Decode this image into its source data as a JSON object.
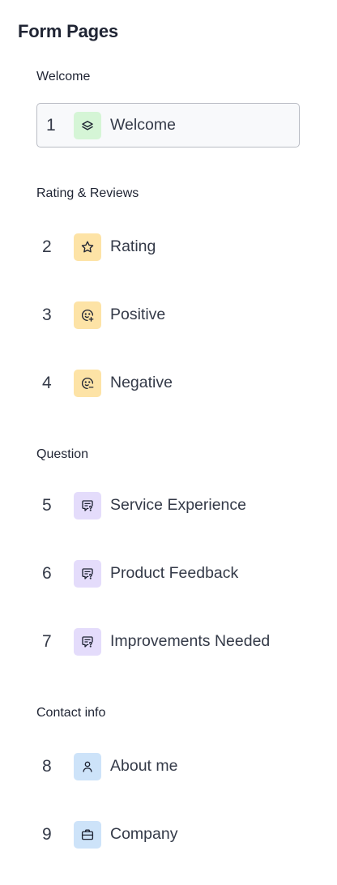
{
  "panel": {
    "title": "Form Pages"
  },
  "sections": [
    {
      "label": "Welcome",
      "items": [
        {
          "number": "1",
          "label": "Welcome",
          "icon": "layers-icon",
          "icon_bg": "#d5f5d6",
          "selected": true
        }
      ]
    },
    {
      "label": "Rating & Reviews",
      "items": [
        {
          "number": "2",
          "label": "Rating",
          "icon": "star-icon",
          "icon_bg": "#fde3a6"
        },
        {
          "number": "3",
          "label": "Positive",
          "icon": "smile-plus-icon",
          "icon_bg": "#fde3a6"
        },
        {
          "number": "4",
          "label": "Negative",
          "icon": "smile-minus-icon",
          "icon_bg": "#fde3a6"
        }
      ]
    },
    {
      "label": "Question",
      "items": [
        {
          "number": "5",
          "label": "Service Experience",
          "icon": "message-question-icon",
          "icon_bg": "#e4dcfb"
        },
        {
          "number": "6",
          "label": "Product Feedback",
          "icon": "message-question-icon",
          "icon_bg": "#e4dcfb"
        },
        {
          "number": "7",
          "label": "Improvements Needed",
          "icon": "message-question-icon",
          "icon_bg": "#e4dcfb"
        }
      ]
    },
    {
      "label": "Contact info",
      "items": [
        {
          "number": "8",
          "label": "About me",
          "icon": "user-icon",
          "icon_bg": "#cde3f9"
        },
        {
          "number": "9",
          "label": "Company",
          "icon": "briefcase-icon",
          "icon_bg": "#cde3f9"
        }
      ]
    }
  ]
}
